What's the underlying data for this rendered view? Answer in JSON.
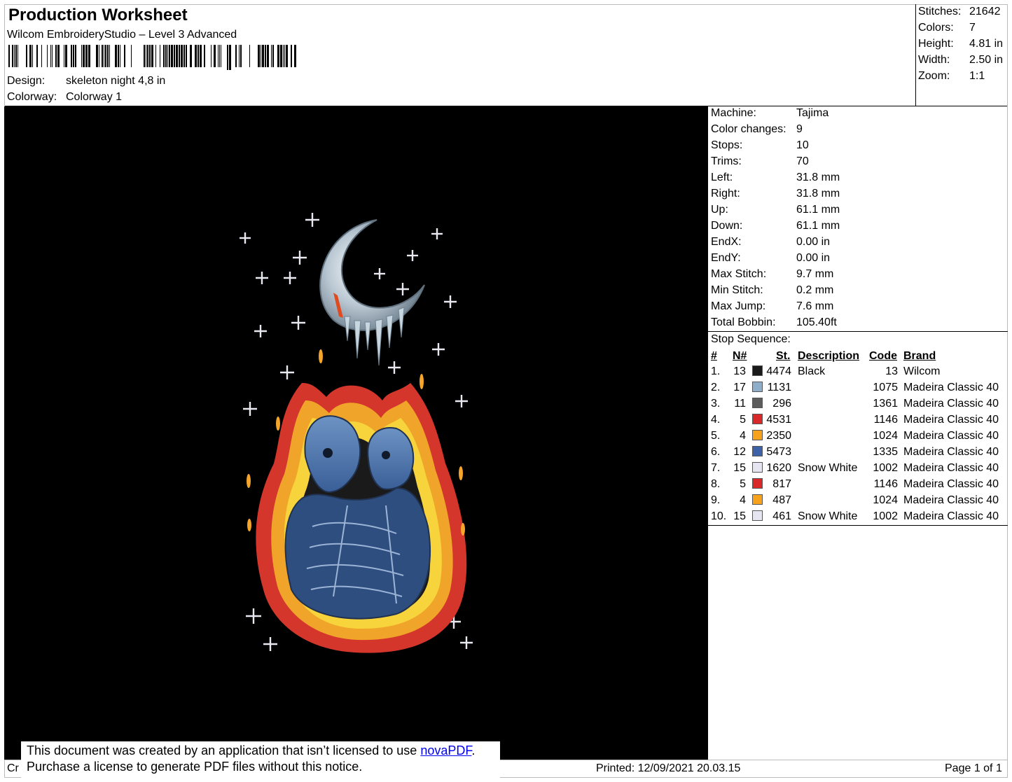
{
  "header": {
    "title": "Production Worksheet",
    "software": "Wilcom EmbroideryStudio – Level 3 Advanced",
    "design_label": "Design:",
    "design_value": "skeleton night 4,8 in",
    "colorway_label": "Colorway:",
    "colorway_value": "Colorway 1"
  },
  "stats": [
    {
      "label": "Stitches:",
      "value": "21642"
    },
    {
      "label": "Colors:",
      "value": "7"
    },
    {
      "label": "Height:",
      "value": "4.81 in"
    },
    {
      "label": "Width:",
      "value": "2.50 in"
    },
    {
      "label": "Zoom:",
      "value": "1:1"
    }
  ],
  "machine_info": [
    {
      "label": "Machine:",
      "value": "Tajima"
    },
    {
      "label": "Color changes:",
      "value": "9"
    },
    {
      "label": "Stops:",
      "value": "10"
    },
    {
      "label": "Trims:",
      "value": "70"
    },
    {
      "label": "Left:",
      "value": "31.8 mm"
    },
    {
      "label": "Right:",
      "value": "31.8 mm"
    },
    {
      "label": "Up:",
      "value": "61.1 mm"
    },
    {
      "label": "Down:",
      "value": "61.1 mm"
    },
    {
      "label": "EndX:",
      "value": "0.00 in"
    },
    {
      "label": "EndY:",
      "value": "0.00 in"
    },
    {
      "label": "Max Stitch:",
      "value": "9.7 mm"
    },
    {
      "label": "Min Stitch:",
      "value": "0.2 mm"
    },
    {
      "label": "Max Jump:",
      "value": "7.6 mm"
    },
    {
      "label": "Total Bobbin:",
      "value": "105.40ft"
    }
  ],
  "stop_sequence": {
    "title": "Stop Sequence:",
    "columns": {
      "num": "#",
      "needle": "N#",
      "stitches": "St.",
      "description": "Description",
      "code": "Code",
      "brand": "Brand"
    },
    "rows": [
      {
        "num": "1.",
        "needle": "13",
        "color": "#1a1a1a",
        "stitches": "4474",
        "description": "Black",
        "code": "13",
        "brand": "Wilcom"
      },
      {
        "num": "2.",
        "needle": "17",
        "color": "#8eaecb",
        "stitches": "1131",
        "description": "",
        "code": "1075",
        "brand": "Madeira Classic 40"
      },
      {
        "num": "3.",
        "needle": "11",
        "color": "#5c5c5c",
        "stitches": "296",
        "description": "",
        "code": "1361",
        "brand": "Madeira Classic 40"
      },
      {
        "num": "4.",
        "needle": "5",
        "color": "#d8282a",
        "stitches": "4531",
        "description": "",
        "code": "1146",
        "brand": "Madeira Classic 40"
      },
      {
        "num": "5.",
        "needle": "4",
        "color": "#f6a21c",
        "stitches": "2350",
        "description": "",
        "code": "1024",
        "brand": "Madeira Classic 40"
      },
      {
        "num": "6.",
        "needle": "12",
        "color": "#3d62a8",
        "stitches": "5473",
        "description": "",
        "code": "1335",
        "brand": "Madeira Classic 40"
      },
      {
        "num": "7.",
        "needle": "15",
        "color": "#e6e6f2",
        "stitches": "1620",
        "description": "Snow White",
        "code": "1002",
        "brand": "Madeira Classic 40"
      },
      {
        "num": "8.",
        "needle": "5",
        "color": "#d8282a",
        "stitches": "817",
        "description": "",
        "code": "1146",
        "brand": "Madeira Classic 40"
      },
      {
        "num": "9.",
        "needle": "4",
        "color": "#f6a21c",
        "stitches": "487",
        "description": "",
        "code": "1024",
        "brand": "Madeira Classic 40"
      },
      {
        "num": "10.",
        "needle": "15",
        "color": "#e6e6f2",
        "stitches": "461",
        "description": "Snow White",
        "code": "1002",
        "brand": "Madeira Classic 40"
      }
    ]
  },
  "footer": {
    "truncated": "Cr",
    "notice_line1": "This document was created by an application that isn’t licensed to use ",
    "notice_link": "novaPDF",
    "notice_end": ".",
    "notice_line2": "Purchase a license to generate PDF files without this notice.",
    "printed": "Printed: 12/09/2021 20.03.15",
    "page": "Page 1 of 1"
  }
}
